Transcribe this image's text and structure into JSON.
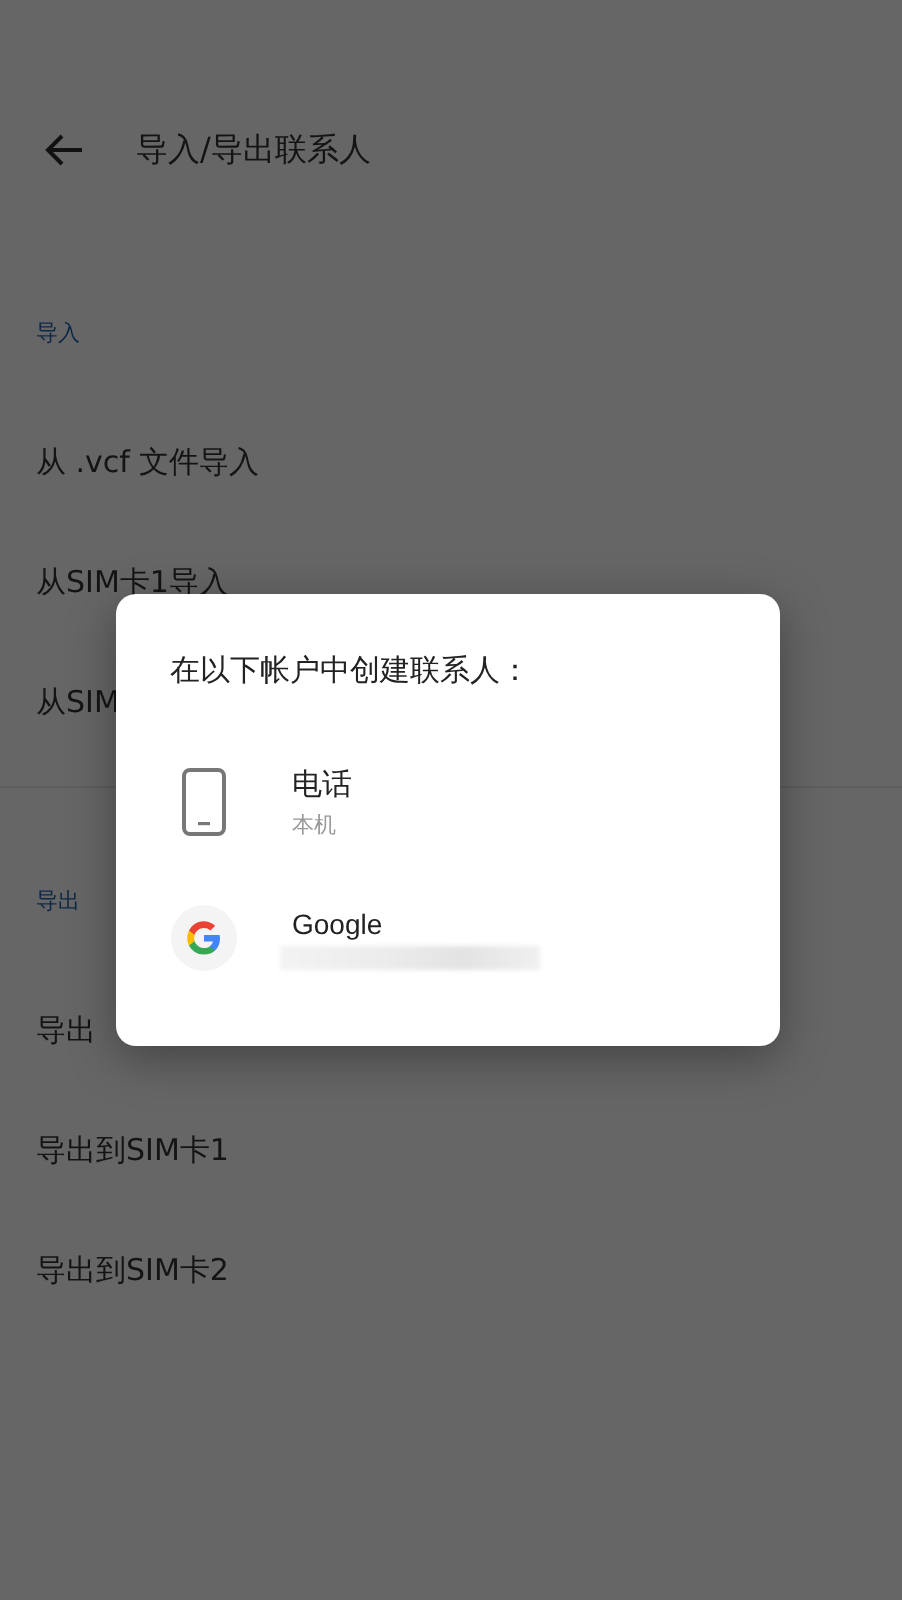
{
  "toolbar": {
    "title": "导入/导出联系人"
  },
  "sections": [
    {
      "header": "导入",
      "items": [
        "从 .vcf 文件导入",
        "从SIM卡1导入",
        "从SIM"
      ]
    },
    {
      "header": "导出",
      "items": [
        "导出",
        "导出到SIM卡1",
        "导出到SIM卡2"
      ]
    }
  ],
  "dialog": {
    "title": "在以下帐户中创建联系人：",
    "accounts": [
      {
        "kind": "phone",
        "name": "电话",
        "subtitle": "本机"
      },
      {
        "kind": "google",
        "name": "Google",
        "subtitle_blurred": true
      }
    ]
  }
}
